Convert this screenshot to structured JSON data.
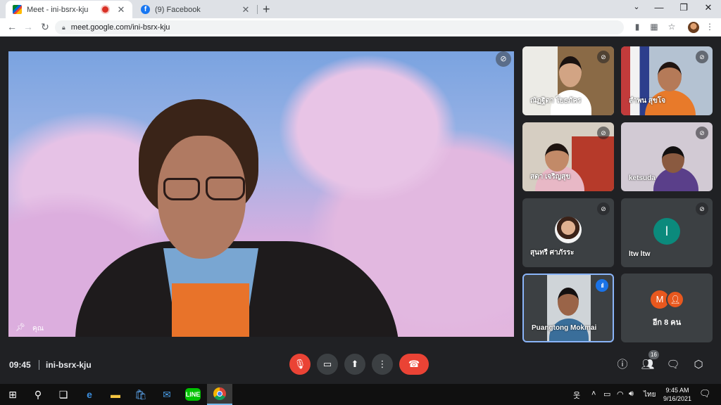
{
  "browser": {
    "tabs": [
      {
        "title": "Meet - ini-bsrx-kju"
      },
      {
        "title": "(9) Facebook"
      }
    ],
    "url": "meet.google.com/ini-bsrx-kju"
  },
  "meeting": {
    "time": "09:45",
    "code": "ini-bsrx-kju",
    "self_label": "คุณ",
    "participant_count": "16"
  },
  "participants": [
    {
      "name": "ณัฏฐิดา โยธภัคร"
    },
    {
      "name": "สำพน สุขโจ"
    },
    {
      "name": "สดา เจริญสุข"
    },
    {
      "name": "ketsuda"
    },
    {
      "name": "สุนทรี ศาภัรระ"
    },
    {
      "name": "ltw ltw",
      "initial": "l"
    },
    {
      "name": "Puangtong Mokmai"
    }
  ],
  "more_tile": {
    "label": "อีก 8 คน",
    "initial": "M"
  },
  "taskbar": {
    "lang": "ไทย",
    "time": "9:45 AM",
    "date": "9/16/2021"
  },
  "colors": {
    "accent_red": "#ea4335",
    "meet_bg": "#202124",
    "tile_bg": "#3c4043",
    "speaking_blue": "#1a73e8"
  }
}
